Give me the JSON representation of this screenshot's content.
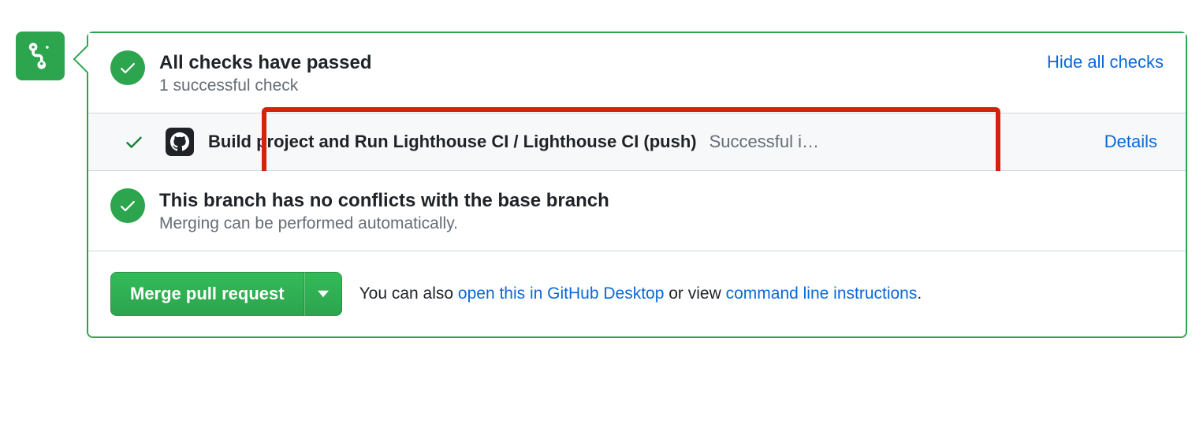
{
  "checks": {
    "title": "All checks have passed",
    "subtitle": "1 successful check",
    "hide_label": "Hide all checks",
    "items": [
      {
        "name": "Build project and Run Lighthouse CI / Lighthouse CI (push)",
        "result": "Successful i…",
        "details_label": "Details"
      }
    ]
  },
  "conflicts": {
    "title": "This branch has no conflicts with the base branch",
    "subtitle": "Merging can be performed automatically."
  },
  "merge": {
    "button_label": "Merge pull request",
    "hint_prefix": "You can also ",
    "open_desktop": "open this in GitHub Desktop",
    "hint_middle": " or view ",
    "cli_instructions": "command line instructions",
    "hint_suffix": "."
  }
}
